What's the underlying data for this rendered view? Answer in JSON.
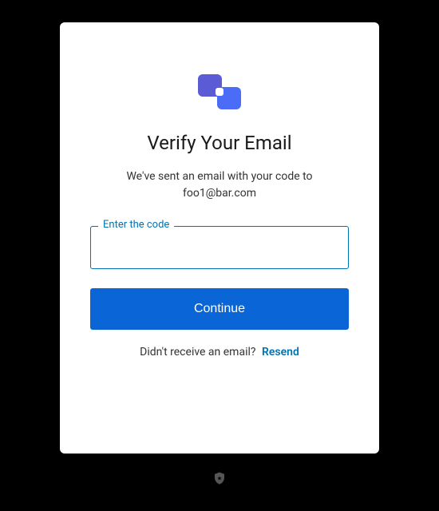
{
  "header": {
    "title": "Verify Your Email",
    "subtitle_line1": "We've sent an email with your code to",
    "email": "foo1@bar.com"
  },
  "form": {
    "code_label": "Enter the code",
    "code_value": "",
    "continue_label": "Continue"
  },
  "resend": {
    "prompt": "Didn't receive an email?",
    "action": "Resend"
  }
}
